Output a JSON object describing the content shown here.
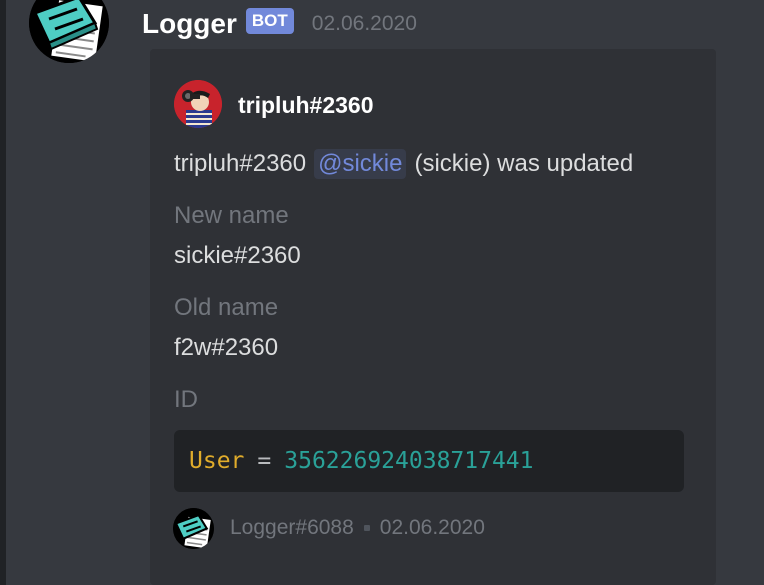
{
  "message": {
    "author": "Logger",
    "badge": "BOT",
    "timestamp": "02.06.2020",
    "avatar_icon": "notepad-icon"
  },
  "embed": {
    "author_icon": "user-avatar-icon",
    "author_name": "tripluh#2360",
    "description": {
      "prefix": "tripluh#2360",
      "mention": "@sickie",
      "suffix": "(sickie) was updated"
    },
    "fields": [
      {
        "name": "New name",
        "value": "sickie#2360"
      },
      {
        "name": "Old name",
        "value": "f2w#2360"
      },
      {
        "name": "ID"
      }
    ],
    "code": {
      "key": "User",
      "operator": "=",
      "value": "356226924038717441"
    },
    "footer": {
      "icon": "notepad-icon",
      "text": "Logger#6088",
      "timestamp": "02.06.2020"
    }
  },
  "colors": {
    "background": "#36393f",
    "embed_background": "#2f3136",
    "code_background": "#202225",
    "bot_badge": "#7289da",
    "mention": "#7289da",
    "code_key": "#e0ac2b",
    "code_value": "#2aa198"
  }
}
